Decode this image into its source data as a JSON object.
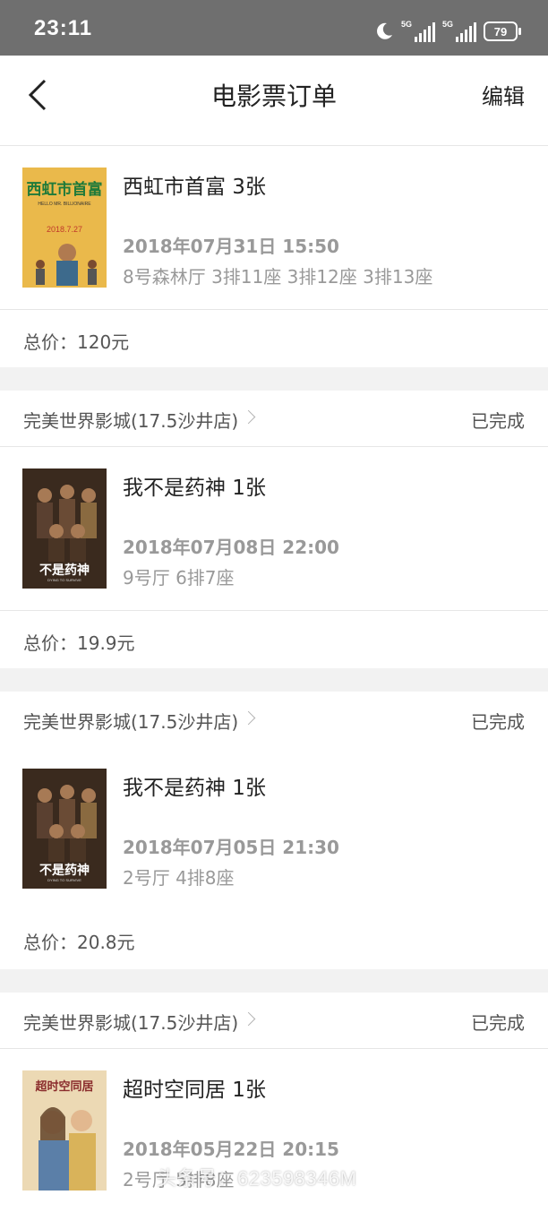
{
  "status_bar": {
    "time": "23:11",
    "network_1": "5G",
    "network_2": "5G",
    "battery": "79",
    "icons": [
      "moon-icon",
      "signal-icon",
      "signal-icon",
      "battery-icon"
    ]
  },
  "nav": {
    "title": "电影票订单",
    "edit_label": "编辑",
    "back_icon": "chevron-left-icon"
  },
  "orders": [
    {
      "movie": "西虹市首富 3张",
      "datetime": "2018年07月31日 15:50",
      "seats": "8号森林厅 3排11座 3排12座 3排13座",
      "total": "总价：120元",
      "poster": {
        "title": "西虹市首富",
        "subtitle": "HELLO MR. BILLIONAIRE",
        "date": "2018.7.27",
        "bg": "#e9b64a"
      }
    },
    {
      "cinema": "完美世界影城(17.5沙井店)",
      "status": "已完成",
      "movie": "我不是药神 1张",
      "datetime": "2018年07月08日 22:00",
      "seats": "9号厅 6排7座",
      "total": "总价：19.9元",
      "poster": {
        "title": "我不是药神",
        "subtitle": "DYING TO SURVIVE",
        "bg": "#3a2a1e"
      }
    },
    {
      "cinema": "完美世界影城(17.5沙井店)",
      "status": "已完成",
      "movie": "我不是药神 1张",
      "datetime": "2018年07月05日 21:30",
      "seats": "2号厅 4排8座",
      "total": "总价：20.8元",
      "poster": {
        "title": "我不是药神",
        "subtitle": "DYING TO SURVIVE",
        "bg": "#3a2a1e"
      }
    },
    {
      "cinema": "完美世界影城(17.5沙井店)",
      "status": "已完成",
      "movie": "超时空同居 1张",
      "datetime": "2018年05月22日 20:15",
      "seats": "2号厅 5排8座",
      "poster": {
        "title": "超时空同居",
        "bg": "#e8d6b0"
      }
    }
  ],
  "watermark": "头条号：623598346M"
}
